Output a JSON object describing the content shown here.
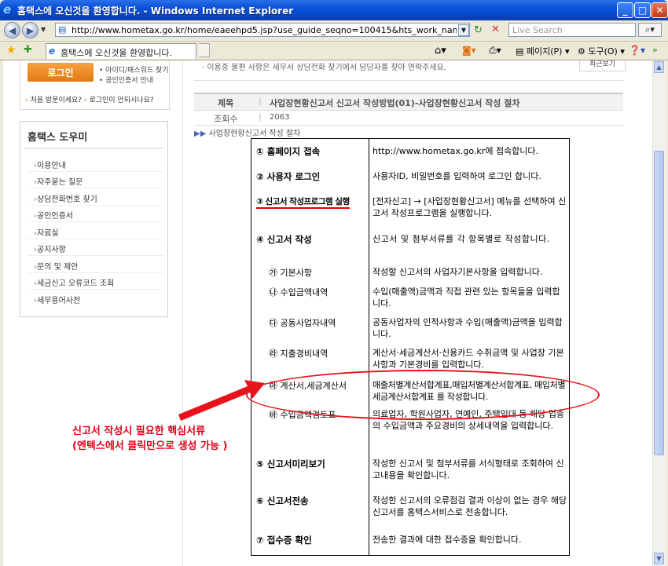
{
  "window": {
    "title": "홈택스에 오신것을 환영합니다. - Windows Internet Explorer",
    "min": "_",
    "max": "□",
    "close": "✕"
  },
  "addressbar": {
    "url": "http://www.hometax.go.kr/home/eaeehpd5.jsp?use_guide_seqno=100415&hts_work_name=&p_search_h",
    "search_placeholder": "Live Search"
  },
  "tab": {
    "label": "홈택스에 오신것을 환영합니다."
  },
  "commandbar": {
    "page_label": "페이지(P)",
    "tools_label": "도구(O)"
  },
  "sidebar": {
    "login_label": "로그인",
    "login_top": "인증하여",
    "links": [
      "아이디/패스워드 찾기",
      "공인인증서 안내"
    ],
    "first_visit": "처음 방문이세요?",
    "login_fail": "로그인이 안되시나요?",
    "help_title": "홈택스 도우미",
    "items": [
      "이용안내",
      "자주묻는 질문",
      "상담전화번호 찾기",
      "공인인증서",
      "자료실",
      "공지사항",
      "문의 및 제안",
      "세금신고 오류코드 조회",
      "세무용어사전"
    ]
  },
  "main": {
    "notice": "· 이용중 불편 사항은 세무서 상담전화 찾기에서 담당자를 찾아 연락주세요.",
    "search_button": "최근보기",
    "title_label": "제목",
    "title_value": "사업장현황신고서 신고서 작성방법(01)-사업장현황신고서 작성 절차",
    "count_label": "조회수",
    "count_value": "2063",
    "breadcrumb": "사업장현황신고서 작성 절차"
  },
  "guide": [
    {
      "label": "① 홈페이지 접속",
      "desc": "http://www.hometax.go.kr에 접속합니다."
    },
    {
      "label": "② 사용자 로그인",
      "desc": "사용자ID, 비밀번호를 입력하여 로그인 합니다."
    },
    {
      "label": "③ 신고서 작성프로그램 실행",
      "desc": "[전자신고] → [사업장현황신고서] 메뉴를 선택하여 신고서 작성프로그램을 실행합니다."
    },
    {
      "label": "④ 신고서 작성",
      "desc": "신고서 및 첨부서류를 각 항목별로 작성합니다."
    },
    {
      "label": "㉮ 기본사항",
      "desc": "작성할 신고서의 사업자기본사항을 입력합니다."
    },
    {
      "label": "㉯ 수입금액내역",
      "desc": "수입(매출액)금액과 직접 관련 있는 항목들을 입력합니다."
    },
    {
      "label": "㉰ 공동사업자내역",
      "desc": "공동사업자의 인적사항과 수입(매출액)금액을 입력합니다."
    },
    {
      "label": "㉱ 지출경비내역",
      "desc": "계산서·세금계산서·신용카드 수취금액 및 사업장 기본사항과 기본경비를 입력합니다."
    },
    {
      "label": "㉲ 계산서,세금계산서",
      "desc": "매출처별계산서합계표,매입처별계산서합계표, 매입처별세금계산서합계표 를 작성합니다."
    },
    {
      "label": "㉳ 수입금액검토표",
      "desc": "의료업자, 학원사업자, 연예인, 주택임대 등 해당 업종의 수입금액과 주요경비의 상세내역을 입력합니다."
    },
    {
      "label": "⑤ 신고서미리보기",
      "desc": "작성한 신고서 및 첨부서류를 서식형태로 조회하여 신고내용을 확인합니다."
    },
    {
      "label": "⑥ 신고서전송",
      "desc": "작성한 신고서의 오류점검 결과 이상이 없는 경우 해당 신고서를 홈택스서비스로 전송합니다."
    },
    {
      "label": "⑦ 접수증 확인",
      "desc": "전송한 결과에 대한 접수증을 확인합니다."
    }
  ],
  "annotation": {
    "line1": "신고서 작성시 필요한 핵심서류",
    "line2": "(엔텍스에서 클릭만으로 생성 가능 )"
  },
  "colors": {
    "titlebar": "#0a50d8",
    "annotation": "#e3001b",
    "login_button": "#f08c20"
  }
}
